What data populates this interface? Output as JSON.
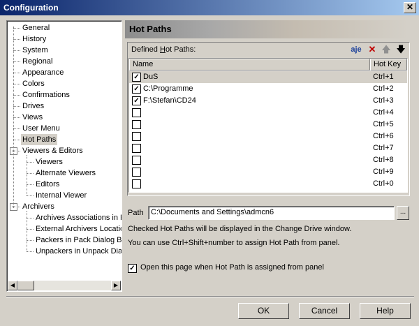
{
  "window": {
    "title": "Configuration",
    "close_glyph": "✕"
  },
  "tree": {
    "items": [
      {
        "label": "General",
        "level": 1
      },
      {
        "label": "History",
        "level": 1
      },
      {
        "label": "System",
        "level": 1
      },
      {
        "label": "Regional",
        "level": 1
      },
      {
        "label": "Appearance",
        "level": 1
      },
      {
        "label": "Colors",
        "level": 1
      },
      {
        "label": "Confirmations",
        "level": 1
      },
      {
        "label": "Drives",
        "level": 1
      },
      {
        "label": "Views",
        "level": 1
      },
      {
        "label": "User Menu",
        "level": 1
      },
      {
        "label": "Hot Paths",
        "level": 1,
        "selected": true
      },
      {
        "label": "Viewers & Editors",
        "level": 0,
        "expanded": true
      },
      {
        "label": "Viewers",
        "level": 2
      },
      {
        "label": "Alternate Viewers",
        "level": 2
      },
      {
        "label": "Editors",
        "level": 2
      },
      {
        "label": "Internal Viewer",
        "level": 2
      },
      {
        "label": "Archivers",
        "level": 0,
        "expanded": true
      },
      {
        "label": "Archives Associations in F",
        "level": 2
      },
      {
        "label": "External Archivers Locatio",
        "level": 2
      },
      {
        "label": "Packers in Pack Dialog B",
        "level": 2
      },
      {
        "label": "Unpackers in Unpack Dia",
        "level": 2
      }
    ],
    "expander_glyph": "−",
    "scroll_left": "◀",
    "scroll_right": "▶"
  },
  "panel": {
    "title": "Hot Paths",
    "group_label": "Defined Hot Paths:",
    "toolbar": {
      "rename_glyph": "a͟e",
      "delete_glyph": "✕",
      "up_glyph": "🡅",
      "down_glyph": "🡇"
    },
    "columns": {
      "name": "Name",
      "hotkey": "Hot Key"
    },
    "rows": [
      {
        "name": "DuS",
        "key": "Ctrl+1",
        "checked": true,
        "selected": true
      },
      {
        "name": "C:\\Programme",
        "key": "Ctrl+2",
        "checked": true
      },
      {
        "name": "F:\\Stefan\\CD24",
        "key": "Ctrl+3",
        "checked": true
      },
      {
        "name": "",
        "key": "Ctrl+4",
        "checked": false
      },
      {
        "name": "",
        "key": "Ctrl+5",
        "checked": false
      },
      {
        "name": "",
        "key": "Ctrl+6",
        "checked": false
      },
      {
        "name": "",
        "key": "Ctrl+7",
        "checked": false
      },
      {
        "name": "",
        "key": "Ctrl+8",
        "checked": false
      },
      {
        "name": "",
        "key": "Ctrl+9",
        "checked": false
      },
      {
        "name": "",
        "key": "Ctrl+0",
        "checked": false
      }
    ],
    "check_glyph": "✓",
    "path_label": "Path",
    "path_value": "C:\\Documents and Settings\\admcn6",
    "browse_label": "...",
    "info1": "Checked Hot Paths will be displayed in the Change Drive window.",
    "info2": "You can use Ctrl+Shift+number to assign Hot Path from panel.",
    "option_label": "Open this page when Hot Path is assigned from panel",
    "option_checked": true
  },
  "buttons": {
    "ok": "OK",
    "cancel": "Cancel",
    "help": "Help"
  }
}
